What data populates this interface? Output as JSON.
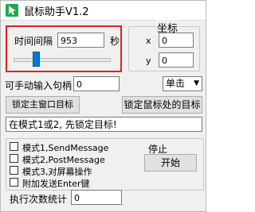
{
  "window": {
    "title": "鼠标助手V1.2"
  },
  "interval": {
    "label": "时间间隔",
    "value": "953",
    "unit": "秒"
  },
  "coords": {
    "group_label": "坐标",
    "x_label": "x",
    "x_value": "0",
    "y_label": "y",
    "y_value": "0"
  },
  "manual_input": {
    "label": "可手动输入句柄",
    "value": "0"
  },
  "click_type": {
    "selected": "单击"
  },
  "buttons": {
    "lock_main": "锁定主窗口目标",
    "lock_mouse": "锁定鼠标处的目标",
    "stop": "停止",
    "start": "开始"
  },
  "status": {
    "message": "在模式1或2, 先锁定目标!"
  },
  "modes": [
    {
      "label": "模式1,SendMessage"
    },
    {
      "label": "模式2,PostMessage"
    },
    {
      "label": "模式3,对屏幕操作"
    },
    {
      "label": "附加发送Enter键"
    }
  ],
  "exec_count": {
    "label": "执行次数统计",
    "value": "0"
  },
  "colors": {
    "highlight_border": "#e02020",
    "accent": "#0078d7"
  }
}
